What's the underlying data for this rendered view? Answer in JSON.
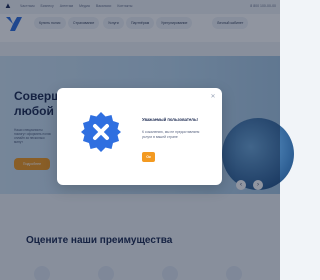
{
  "topbar": {
    "links": [
      "Частным",
      "Бизнесу",
      "Агентам",
      "Медиа",
      "Вакансии",
      "Контакты"
    ],
    "phone": "8 800 100-00-00"
  },
  "nav": {
    "items": [
      "Купить полис",
      "Страхование",
      "Услуги",
      "Партнёрам",
      "Урегулирование",
      "Личный кабинет"
    ]
  },
  "hero": {
    "title_line1": "Соверша",
    "title_line2": "любой то",
    "text": "Наши специалисты помогут оформить полис онлайн за несколько минут",
    "button": "Подробнее"
  },
  "section": {
    "title": "Оцените наши преимущества"
  },
  "modal": {
    "title": "Уважаемый пользователь!",
    "text": "К сожалению, мы не предоставляем услуги в вашей стране",
    "ok_button": "Ок",
    "close_icon": "close-icon",
    "badge_icon": "blocked-badge-icon"
  },
  "colors": {
    "accent": "#f39a21",
    "brand": "#2f6fe0",
    "overlay": "#0d1830"
  }
}
